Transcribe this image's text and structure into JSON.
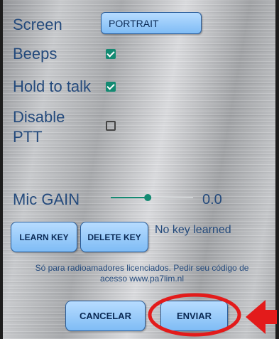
{
  "settings": {
    "screen_label": "Screen",
    "screen_value": "PORTRAIT",
    "beeps_label": "Beeps",
    "beeps_checked": true,
    "hold_to_talk_label": "Hold to talk",
    "hold_to_talk_checked": true,
    "disable_ptt_label_line1": "Disable",
    "disable_ptt_label_line2": "PTT",
    "disable_ptt_checked": false,
    "mic_gain_label": "Mic GAIN",
    "mic_gain_value": "0.0",
    "mic_gain_level": 0.45
  },
  "keys": {
    "learn_key": "LEARN KEY",
    "delete_key": "DELETE KEY",
    "status": "No key learned"
  },
  "notice": {
    "line1": "Só para radioamadores licenciados. Pedir seu código de",
    "line2": "acesso www.pa7lim.nl"
  },
  "actions": {
    "cancel": "CANCELAR",
    "send": "ENVIAR"
  },
  "colors": {
    "label_text": "#244a7c",
    "button_fill": "#9fd0fb",
    "checkbox_checked": "#138a72",
    "highlight_red": "#e31b1b",
    "slider": "#138a72"
  }
}
